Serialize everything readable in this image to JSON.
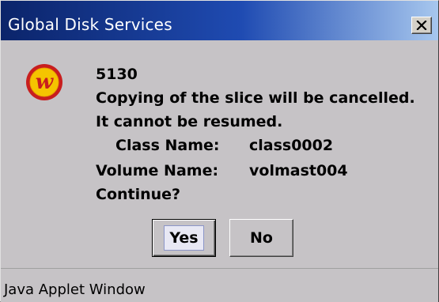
{
  "window": {
    "title": "Global Disk Services",
    "close_label": "×"
  },
  "dialog": {
    "icon": "w-logo-icon",
    "code": "5130",
    "line1": "Copying of the slice will be cancelled.",
    "line2": "It cannot be resumed.",
    "class_label": "Class Name:",
    "class_value": "class0002",
    "volume_label": "Volume Name:",
    "volume_value": "volmast004",
    "question": "Continue?"
  },
  "buttons": {
    "yes_label": "Yes",
    "no_label": "No"
  },
  "statusbar": {
    "text": "Java Applet Window"
  },
  "colors": {
    "title_bar_start": "#0b246a",
    "title_bar_end": "#a7c7ee",
    "dialog_bg": "#c6c3c6",
    "icon_red": "#c81e1e",
    "icon_yellow": "#f5c400"
  }
}
